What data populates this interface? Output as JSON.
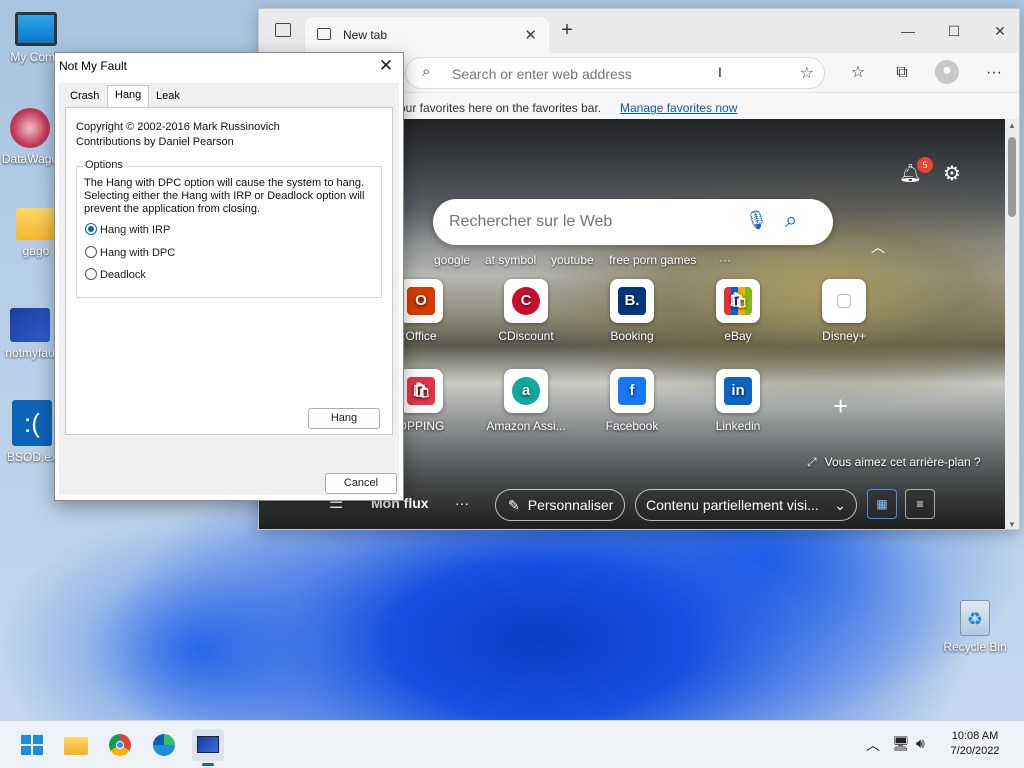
{
  "desktop": {
    "icons": [
      {
        "label": "My Comp"
      },
      {
        "label": "DataWago"
      },
      {
        "label": "gago"
      },
      {
        "label": "notmyfau"
      },
      {
        "label": "BSOD.ex"
      },
      {
        "label": "Recycle Bin"
      }
    ]
  },
  "browser": {
    "tab": {
      "title": "New tab"
    },
    "window_controls": {
      "minimize": "—",
      "maximize": "☐",
      "close": "✕"
    },
    "address_placeholder": "Search or enter web address",
    "favorites_bar": {
      "text": "our favorites here on the favorites bar.",
      "link": "Manage favorites now"
    },
    "ntp": {
      "notification_count": "5",
      "search_placeholder": "Rechercher sur le Web",
      "quick_links": [
        "google",
        "at symbol",
        "youtube",
        "free porn games",
        "···"
      ],
      "tiles_row1": [
        {
          "label": "Office",
          "letter": "O",
          "color": "#d83b01"
        },
        {
          "label": "CDiscount",
          "letter": "C",
          "color": "#c8102e"
        },
        {
          "label": "Booking",
          "letter": "B.",
          "color": "#003580"
        },
        {
          "label": "eBay",
          "letter": "🛍",
          "color": "#0064d2"
        },
        {
          "label": "Disney+",
          "letter": "",
          "color": "#ffffff"
        }
      ],
      "tiles_row2": [
        {
          "label": "OPPING",
          "letter": "🛍",
          "color": "#e6334a"
        },
        {
          "label": "Amazon Assi...",
          "letter": "a",
          "color": "#12a89d"
        },
        {
          "label": "Facebook",
          "letter": "f",
          "color": "#1877f2"
        },
        {
          "label": "Linkedin",
          "letter": "in",
          "color": "#0a66c2"
        }
      ],
      "add_tile": "+",
      "background_question": "Vous aimez cet arrière-plan ?",
      "my_feed": "Mon flux",
      "more": "···",
      "personalize": "Personnaliser",
      "content_select": "Contenu partiellement visi..."
    }
  },
  "dialog": {
    "title": "Not My Fault",
    "tabs": [
      "Crash",
      "Hang",
      "Leak"
    ],
    "active_tab": "Hang",
    "copyright": "Copyright © 2002-2016 Mark Russinovich",
    "contributions": "Contributions by Daniel Pearson",
    "options_legend": "Options",
    "options_text": "The Hang with DPC option will cause the system to hang. Selecting either the Hang with IRP or Deadlock option will prevent the application from closing.",
    "radios": [
      {
        "label": "Hang with IRP",
        "checked": true
      },
      {
        "label": "Hang with DPC",
        "checked": false
      },
      {
        "label": "Deadlock",
        "checked": false
      }
    ],
    "hang_button": "Hang",
    "cancel_button": "Cancel"
  },
  "taskbar": {
    "time": "10:08 AM",
    "date": "7/20/2022"
  },
  "colors": {
    "accent": "#0a64c8",
    "link": "#0b5cb0",
    "notification_badge": "#e8452c"
  }
}
